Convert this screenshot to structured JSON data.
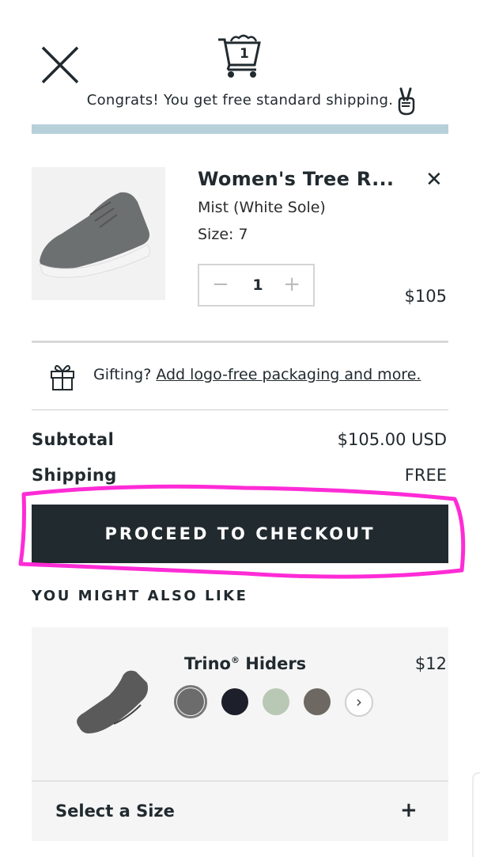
{
  "header": {
    "cart_count": "1",
    "free_shipping_msg": "Congrats! You get free standard shipping.",
    "progress": 1.0
  },
  "cart_item": {
    "name": "Women's Tree R...",
    "variant": "Mist (White Sole)",
    "size": "Size: 7",
    "quantity": "1",
    "price": "$105",
    "remove_label": "✕",
    "qty_minus": "−",
    "qty_plus": "+"
  },
  "gift": {
    "prefix": "Gifting?",
    "link": "Add logo-free packaging and more."
  },
  "summary": {
    "subtotal_label": "Subtotal",
    "subtotal_value": "$105.00 USD",
    "shipping_label": "Shipping",
    "shipping_value": "FREE"
  },
  "checkout": {
    "label": "PROCEED TO CHECKOUT"
  },
  "recommendations": {
    "heading": "YOU MIGHT ALSO LIKE",
    "item": {
      "name": "Trino",
      "registered": "®",
      "name_suffix": "Hiders",
      "price": "$12",
      "swatches": [
        "#6c6c6c",
        "#1d1f2b",
        "#b9c8b5",
        "#6e6862"
      ],
      "next_label": "›",
      "select_size": "Select a Size",
      "select_plus": "+"
    }
  },
  "colors": {
    "accent_dark": "#212a2f",
    "progress_bar": "#b8d0da",
    "annotation": "#ff2bd6"
  }
}
